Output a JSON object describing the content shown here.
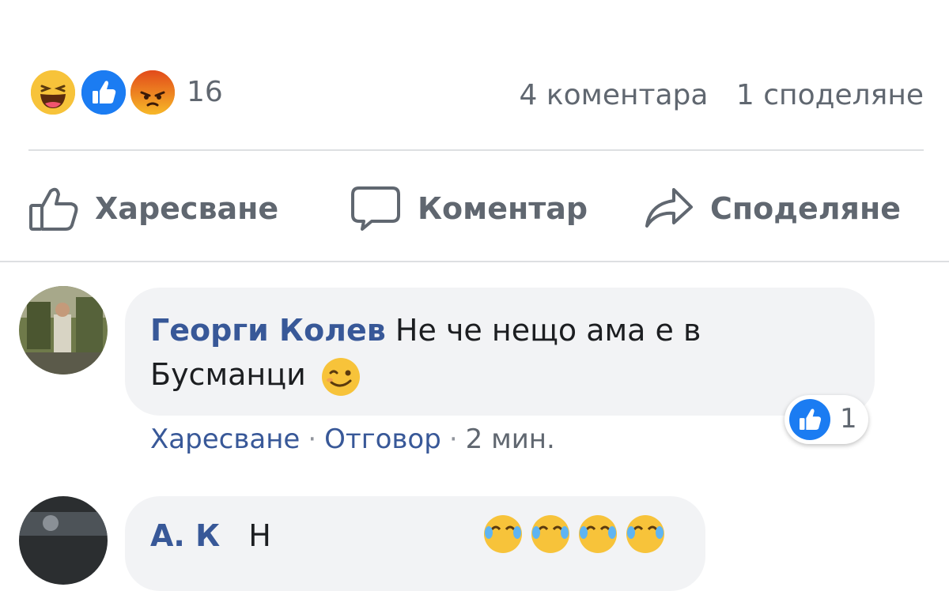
{
  "reactions": {
    "icons": [
      "haha-icon",
      "like-icon",
      "angry-icon"
    ],
    "count": "16"
  },
  "stats": {
    "comments": "4 коментара",
    "shares": "1 споделяне"
  },
  "actions": {
    "like": "Харесване",
    "comment": "Коментар",
    "share": "Споделяне"
  },
  "comments": [
    {
      "author": "Георги Колев",
      "text_line1": "Не че нещо ама е в",
      "text_line2": "Бусманци",
      "emoji": "wink-emoji-icon",
      "like_count": "1",
      "like_action": "Харесване",
      "reply_action": "Отговор",
      "time": "2 мин."
    },
    {
      "author": "А. К",
      "text_partial": "Н",
      "emojis": [
        "laughing-crying-icon",
        "laughing-crying-icon",
        "laughing-crying-icon",
        "laughing-crying-icon"
      ]
    }
  ],
  "colors": {
    "link_blue": "#385898",
    "meta_gray": "#606770",
    "like_blue": "#1877f2",
    "haha_yellow": "#f7b928",
    "angry_orange": "#e9710f",
    "bubble_bg": "#f2f3f5",
    "divider": "#dddfe2"
  }
}
